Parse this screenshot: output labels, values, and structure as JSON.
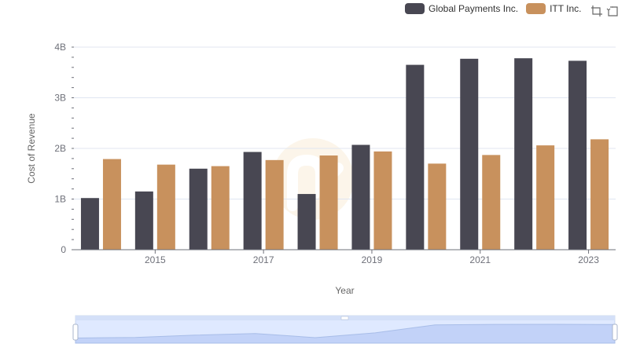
{
  "legend": {
    "items": [
      {
        "label": "Global Payments Inc.",
        "color": "#484752"
      },
      {
        "label": "ITT Inc.",
        "color": "#c8915d"
      }
    ]
  },
  "toolbox": [
    "zoom-icon",
    "restore-icon"
  ],
  "chart_data": {
    "type": "bar",
    "categories": [
      "2014",
      "2015",
      "2016",
      "2017",
      "2018",
      "2019",
      "2020",
      "2021",
      "2022",
      "2023"
    ],
    "series": [
      {
        "name": "Global Payments Inc.",
        "color": "#484752",
        "values": [
          1.02,
          1.15,
          1.6,
          1.93,
          1.1,
          2.07,
          3.65,
          3.77,
          3.78,
          3.73
        ]
      },
      {
        "name": "ITT Inc.",
        "color": "#c8915d",
        "values": [
          1.79,
          1.68,
          1.65,
          1.77,
          1.86,
          1.94,
          1.7,
          1.87,
          2.06,
          2.18
        ]
      }
    ],
    "ylabel": "Cost of Revenue",
    "xlabel": "Year",
    "y_ticks": [
      "0",
      "1B",
      "2B",
      "3B",
      "4B"
    ],
    "x_tick_labels": [
      "2015",
      "2017",
      "2019",
      "2021",
      "2023"
    ],
    "ylim": [
      0,
      4
    ],
    "y_unit": "billions",
    "grid": true,
    "legend_position": "top-right",
    "has_datazoom_slider": true
  }
}
